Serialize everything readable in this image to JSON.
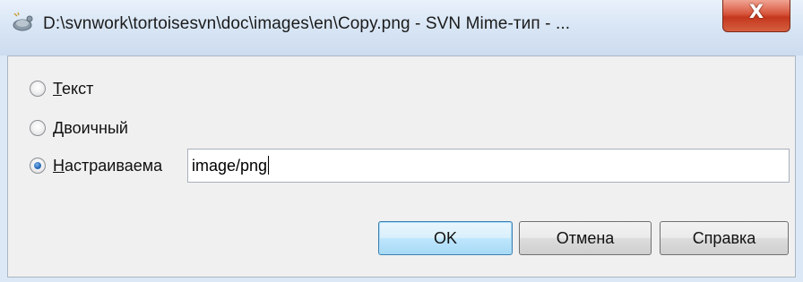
{
  "window": {
    "title": "D:\\svnwork\\tortoisesvn\\doc\\images\\en\\Copy.png - SVN Mime-тип - ...",
    "icon": "tortoisesvn-icon",
    "close_glyph": "X"
  },
  "options": [
    {
      "accel": "Т",
      "rest": "екст",
      "checked": false
    },
    {
      "accel": "Д",
      "rest": "воичный",
      "checked": false
    },
    {
      "accel": "Н",
      "rest": "астраиваема",
      "checked": true
    }
  ],
  "custom_input": {
    "value": "image/png"
  },
  "buttons": {
    "ok": "OK",
    "cancel": "Отмена",
    "help": "Справка"
  }
}
